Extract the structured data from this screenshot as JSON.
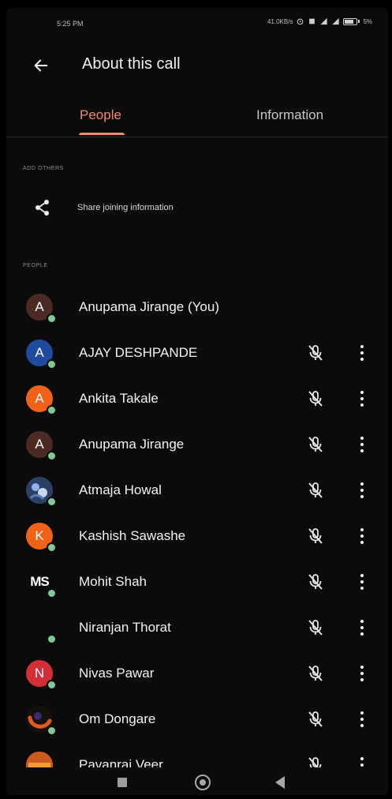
{
  "status_bar": {
    "time": "5:25 PM",
    "network": "41.0KB/s",
    "battery": "5%"
  },
  "app_bar": {
    "title": "About this call",
    "back_icon": "arrow-left-icon"
  },
  "tabs": [
    {
      "label": "People",
      "selected": true
    },
    {
      "label": "Information",
      "selected": false
    }
  ],
  "sections": {
    "add_others": "ADD OTHERS",
    "people": "PEOPLE"
  },
  "share": {
    "label": "Share joining information",
    "icon": "share-icon"
  },
  "participants": [
    {
      "initial": "A",
      "name": "Anupama Jirange (You)",
      "color": "#4a2a22",
      "controls": false
    },
    {
      "initial": "A",
      "name": "AJAY DESHPANDE",
      "color": "#1f4a9f",
      "controls": true
    },
    {
      "initial": "A",
      "name": "Ankita Takale",
      "color": "#f06218",
      "controls": true
    },
    {
      "initial": "A",
      "name": "Anupama Jirange",
      "color": "#4a2a22",
      "controls": true
    },
    {
      "initial": "",
      "name": "Atmaja Howal",
      "color": "#2d3f62",
      "controls": true
    },
    {
      "initial": "K",
      "name": "Kashish Sawashe",
      "color": "#f06218",
      "controls": true
    },
    {
      "initial": "MS",
      "name": "Mohit Shah",
      "color": "#0b0b0b",
      "controls": true
    },
    {
      "initial": "",
      "name": "Niranjan Thorat",
      "color": "#0b0b0b",
      "controls": true
    },
    {
      "initial": "N",
      "name": "Nivas Pawar",
      "color": "#d32f39",
      "controls": true
    },
    {
      "initial": "",
      "name": "Om Dongare",
      "color": "#5a2a1b",
      "controls": true
    },
    {
      "initial": "",
      "name": "Pavanraj Veer",
      "color": "#cc5a1e",
      "controls": true
    }
  ],
  "colors": {
    "accent": "#f28b6b",
    "background": "#0b0b0b",
    "online": "#81c995"
  },
  "icons": {
    "mic_off": "mic-off-icon",
    "more": "more-vert-icon"
  },
  "nav": {
    "recents": "recents-icon",
    "home": "home-icon",
    "back": "back-icon"
  }
}
